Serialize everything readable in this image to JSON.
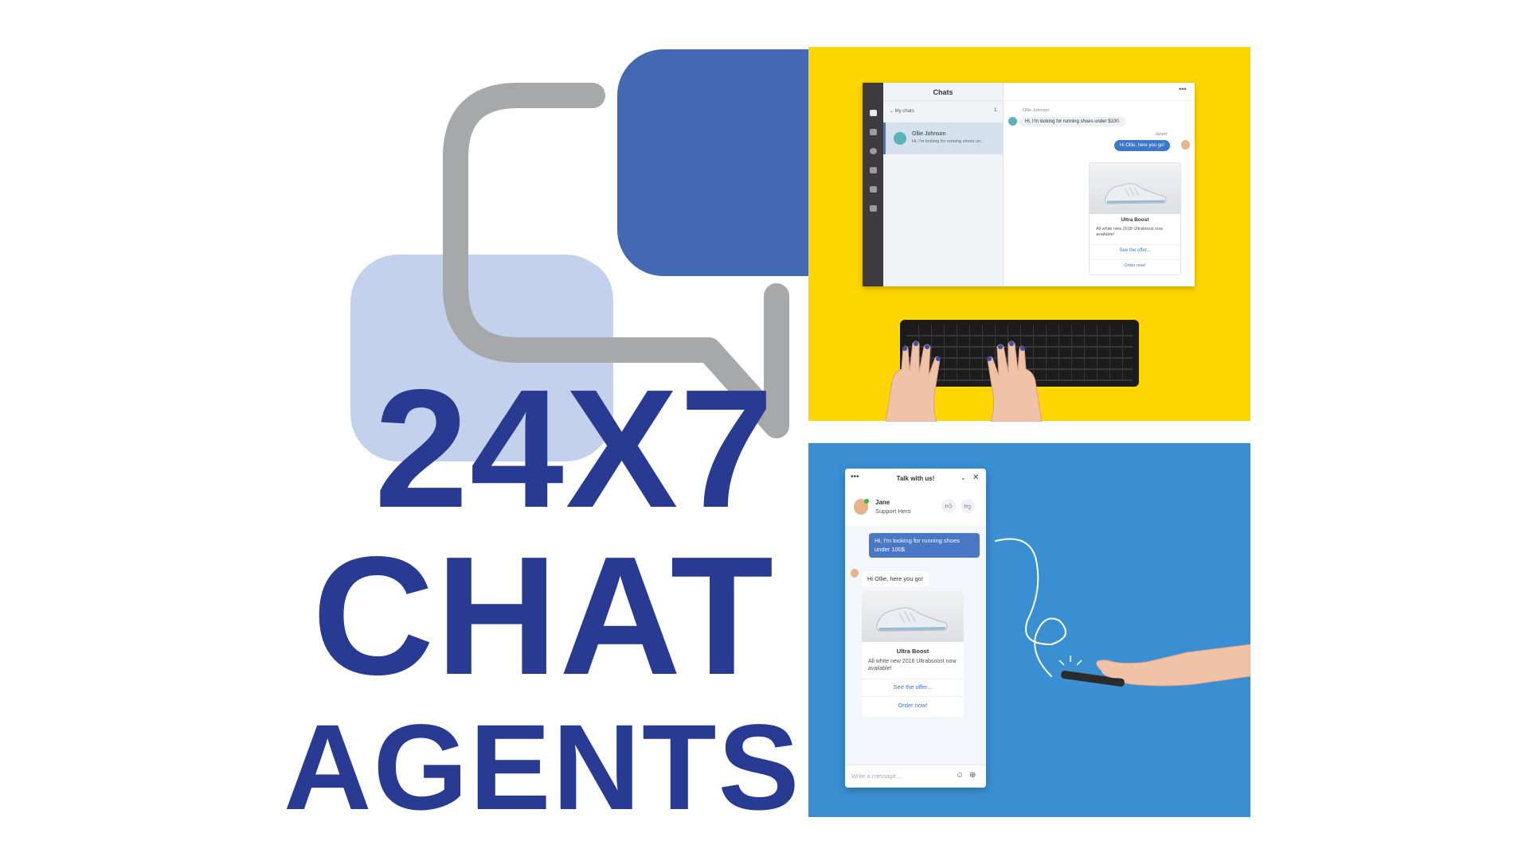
{
  "headline": {
    "line1": "24X7",
    "line2": "CHAT",
    "line3": "AGENTS"
  },
  "colors": {
    "headline": "#283a91",
    "bubble_dark": "#4469b3",
    "bubble_light": "#c3d1ec",
    "bubble_outline": "#a7a8aa",
    "panel_yellow": "#fdd500",
    "panel_blue": "#3a8fd2",
    "agent_bubble": "#3c77c8"
  },
  "desktop_app": {
    "title": "Chats",
    "menu_icon": "more-dots-icon",
    "rail_icons": [
      "chat-icon",
      "contacts-icon",
      "history-icon",
      "archive-icon",
      "team-icon",
      "reports-icon"
    ],
    "section_label": "My chats",
    "section_count": "1",
    "chat_item": {
      "name": "Ollie Johnson",
      "preview": "Hi, I'm looking for running shoes un..."
    },
    "conversation": {
      "customer_name": "Ollie Johnson",
      "customer_message": "Hi, I'm looking for running shoes under $100.",
      "agent_name": "Janett",
      "agent_message": "Hi Ollie, here you go!",
      "card": {
        "title": "Ultra Boost",
        "description": "All white new 2018 Ultraboost now available!",
        "link1": "See the offer...",
        "link2": "Order now!"
      }
    }
  },
  "widget": {
    "title": "Talk with us!",
    "icons": {
      "menu": "more-dots-icon",
      "minimize": "chevron-down-icon",
      "close": "close-icon",
      "thumbs_up": "thumbs-up-icon",
      "thumbs_down": "thumbs-down-icon",
      "emoji": "emoji-icon",
      "attach": "attachment-icon"
    },
    "agent_name": "Jane",
    "agent_role": "Support Hero",
    "customer_message": "Hi, I'm looking for running shoes under 100$",
    "agent_message": "Hi Ollie, here you go!",
    "card": {
      "title": "Ultra Boost",
      "description": "All white new 2018 Ultrabsoost now available!",
      "link1": "See the offer...",
      "link2": "Order now!"
    },
    "input_placeholder": "Write a message..."
  }
}
